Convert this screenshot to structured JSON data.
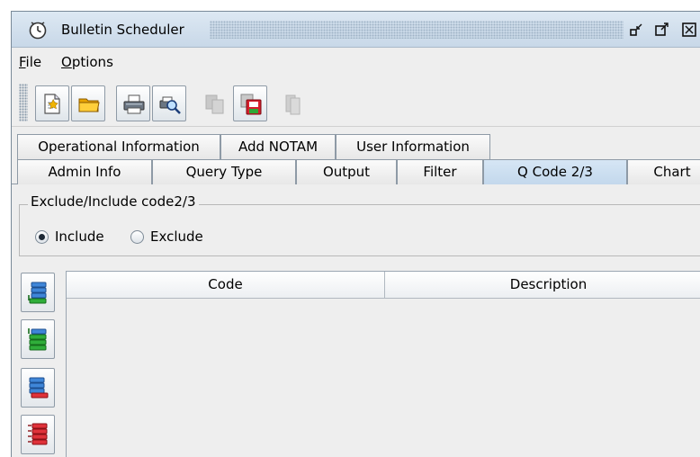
{
  "window": {
    "title": "Bulletin Scheduler",
    "icon": "clock-icon"
  },
  "menu": [
    {
      "label": "File",
      "mnemonic": "F",
      "rest": "ile"
    },
    {
      "label": "Options",
      "mnemonic": "O",
      "rest": "ptions"
    }
  ],
  "toolbar": {
    "buttons": [
      {
        "name": "new-document-button",
        "icon": "new-document-icon",
        "enabled": true
      },
      {
        "name": "open-folder-button",
        "icon": "folder-icon",
        "enabled": true
      },
      {
        "name": "print-button",
        "icon": "printer-icon",
        "enabled": true
      },
      {
        "name": "print-preview-button",
        "icon": "print-preview-icon",
        "enabled": true
      },
      {
        "name": "copy-button",
        "icon": "copy-icon",
        "enabled": false
      },
      {
        "name": "save-button",
        "icon": "save-icon",
        "enabled": true
      },
      {
        "name": "paste-button",
        "icon": "paste-icon",
        "enabled": false
      }
    ]
  },
  "tabs": {
    "back_row": [
      "Operational Information",
      "Add NOTAM",
      "User Information"
    ],
    "front_row": [
      "Admin Info",
      "Query Type",
      "Output",
      "Filter",
      "Q Code 2/3",
      "Chart"
    ],
    "selected": "Q Code 2/3"
  },
  "group": {
    "legend": "Exclude/Include code2/3",
    "options": [
      "Include",
      "Exclude"
    ],
    "selected": "Include"
  },
  "side_buttons": [
    {
      "name": "add-item-button",
      "icon": "add-list-item-icon"
    },
    {
      "name": "add-all-button",
      "icon": "add-all-items-icon"
    },
    {
      "name": "remove-item-button",
      "icon": "remove-list-item-icon"
    },
    {
      "name": "remove-all-button",
      "icon": "remove-all-items-icon"
    }
  ],
  "table": {
    "columns": [
      "Code",
      "Description"
    ],
    "rows": []
  },
  "colors": {
    "selected_tab": "#c3d8ec",
    "title_bar": "#c8d8e8",
    "window_bg": "#eeeeee"
  }
}
